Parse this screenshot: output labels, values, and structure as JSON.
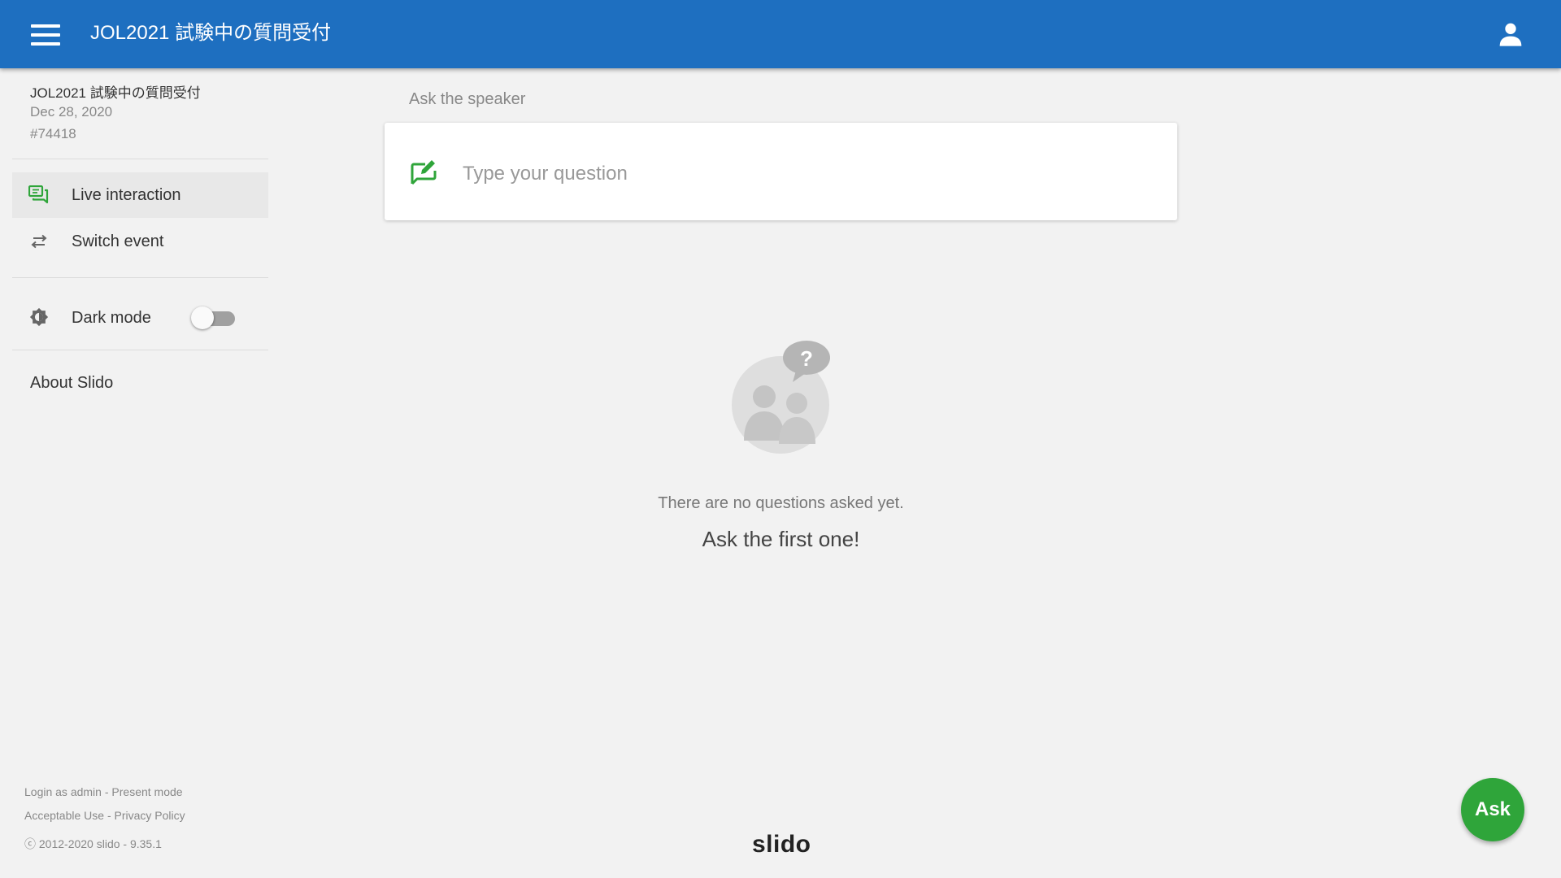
{
  "header": {
    "menu_icon": "hamburger-menu-icon",
    "title": "JOL2021 試験中の質問受付",
    "user_icon": "person-icon",
    "color": "#1e6fc0"
  },
  "sidebar": {
    "event": {
      "title": "JOL2021 試験中の質問受付",
      "date": "Dec 28, 2020",
      "code": "#74418"
    },
    "nav": [
      {
        "label": "Live interaction",
        "icon": "chat-bubbles-icon",
        "active": true
      },
      {
        "label": "Switch event",
        "icon": "swap-arrows-icon",
        "active": false
      }
    ],
    "dark_mode": {
      "label": "Dark mode",
      "icon": "brightness-icon",
      "enabled": false
    },
    "about_label": "About Slido",
    "footer": {
      "login_admin": "Login as admin",
      "present_mode": "Present mode",
      "acceptable_use": "Acceptable Use",
      "privacy_policy": "Privacy Policy",
      "copyright": "ⓒ 2012-2020 slido - 9.35.1"
    }
  },
  "main": {
    "section_label": "Ask the speaker",
    "input_placeholder": "Type your question",
    "compose_icon": "compose-question-icon",
    "empty_illustration": "people-question-bubble-icon",
    "empty_text": "There are no questions asked yet.",
    "empty_cta": "Ask the first one!"
  },
  "brand": "slido",
  "fab": {
    "label": "Ask",
    "color": "#2fa53a"
  },
  "accent_color": "#2fa53a"
}
